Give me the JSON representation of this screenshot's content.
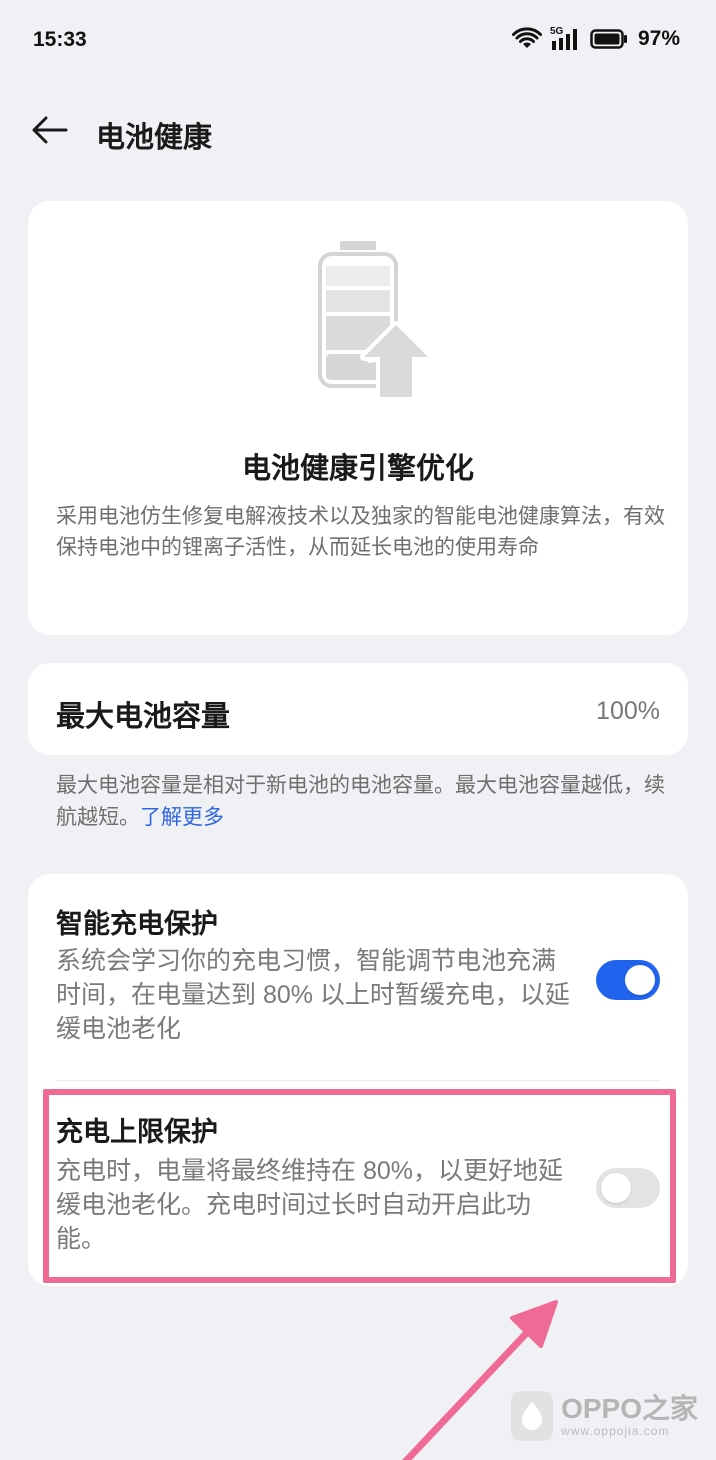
{
  "status_bar": {
    "time": "15:33",
    "network": "5G",
    "battery_percent": "97%"
  },
  "header": {
    "title": "电池健康"
  },
  "hero": {
    "icon": "battery-upload-icon",
    "title": "电池健康引擎优化",
    "description": "采用电池仿生修复电解液技术以及独家的智能电池健康算法，有效保持电池中的锂离子活性，从而延长电池的使用寿命"
  },
  "capacity": {
    "label": "最大电池容量",
    "value": "100%",
    "note": "最大电池容量是相对于新电池的电池容量。最大电池容量越低，续航越短。",
    "learn_more": "了解更多"
  },
  "settings": {
    "smart_charging": {
      "title": "智能充电保护",
      "description": "系统会学习你的充电习惯，智能调节电池充满时间，在电量达到 80% 以上时暂缓充电，以延缓电池老化",
      "enabled": true
    },
    "charge_limit": {
      "title": "充电上限保护",
      "description": "充电时，电量将最终维持在 80%，以更好地延缓电池老化。充电时间过长时自动开启此功能。",
      "enabled": false
    }
  },
  "annotation": {
    "highlight_color": "#ef6b95"
  },
  "watermark": {
    "title": "OPPO之家",
    "url": "www.oppojia.com"
  },
  "colors": {
    "accent": "#1f63ee",
    "link": "#2f66e6",
    "background": "#f0f1f4"
  }
}
